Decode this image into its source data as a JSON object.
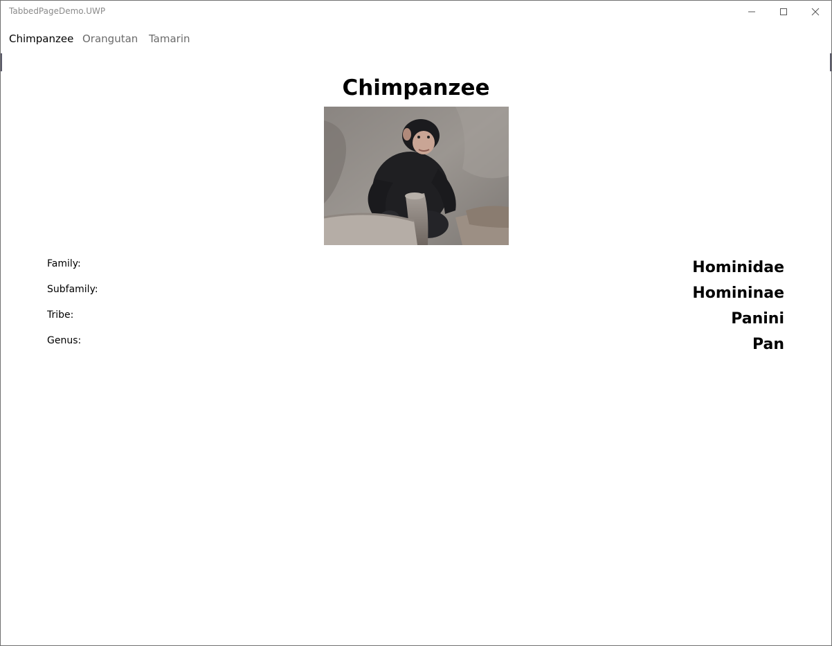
{
  "window": {
    "title": "TabbedPageDemo.UWP",
    "controls": {
      "minimize_icon": "minimize-icon",
      "maximize_icon": "maximize-icon",
      "close_icon": "close-icon"
    }
  },
  "tabs": [
    {
      "label": "Chimpanzee",
      "active": true
    },
    {
      "label": "Orangutan",
      "active": false
    },
    {
      "label": "Tamarin",
      "active": false
    }
  ],
  "page": {
    "title": "Chimpanzee",
    "photo_alt": "chimpanzee-photo",
    "details": [
      {
        "label": "Family:",
        "value": "Hominidae"
      },
      {
        "label": "Subfamily:",
        "value": "Homininae"
      },
      {
        "label": "Tribe:",
        "value": "Panini"
      },
      {
        "label": "Genus:",
        "value": "Pan"
      }
    ]
  },
  "colors": {
    "active_tab": "#000000",
    "inactive_tab": "#6a6a6a",
    "title_text": "#8a8a8a"
  }
}
